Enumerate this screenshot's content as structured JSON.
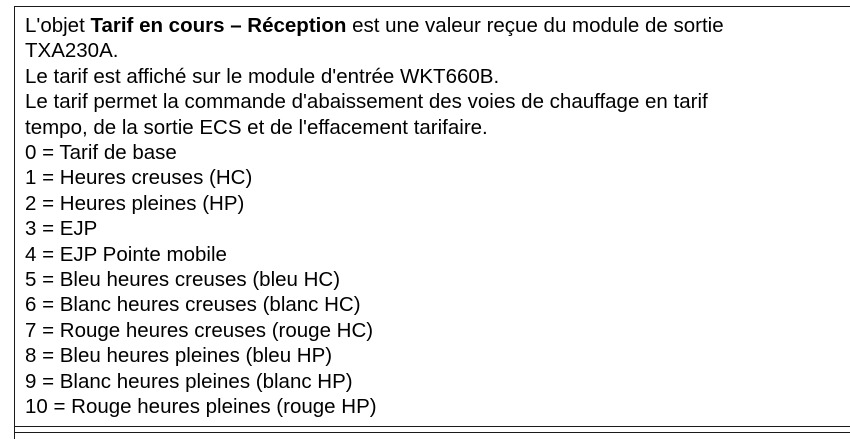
{
  "description": {
    "intro_prefix": "L'objet ",
    "object_name": "Tarif en cours – Réception",
    "intro_suffix": " est une valeur reçue du module de sortie",
    "intro_line2": "TXA230A.",
    "display_sentence": "Le tarif est affiché sur le module d'entrée WKT660B.",
    "command_line1": "Le tarif permet la commande d'abaissement des voies de chauffage en tarif",
    "command_line2": "tempo, de la sortie ECS et de l'effacement tarifaire."
  },
  "tariff_values": [
    "0 = Tarif de base",
    "1 = Heures creuses (HC)",
    "2 = Heures pleines (HP)",
    "3 = EJP",
    "4 = EJP Pointe mobile",
    "5 = Bleu heures creuses (bleu HC)",
    "6 = Blanc heures creuses (blanc HC)",
    "7 = Rouge heures creuses (rouge HC)",
    "8 = Bleu heures pleines (bleu HP)",
    "9 = Blanc heures pleines (blanc HP)",
    "10 = Rouge heures pleines (rouge HP)"
  ]
}
